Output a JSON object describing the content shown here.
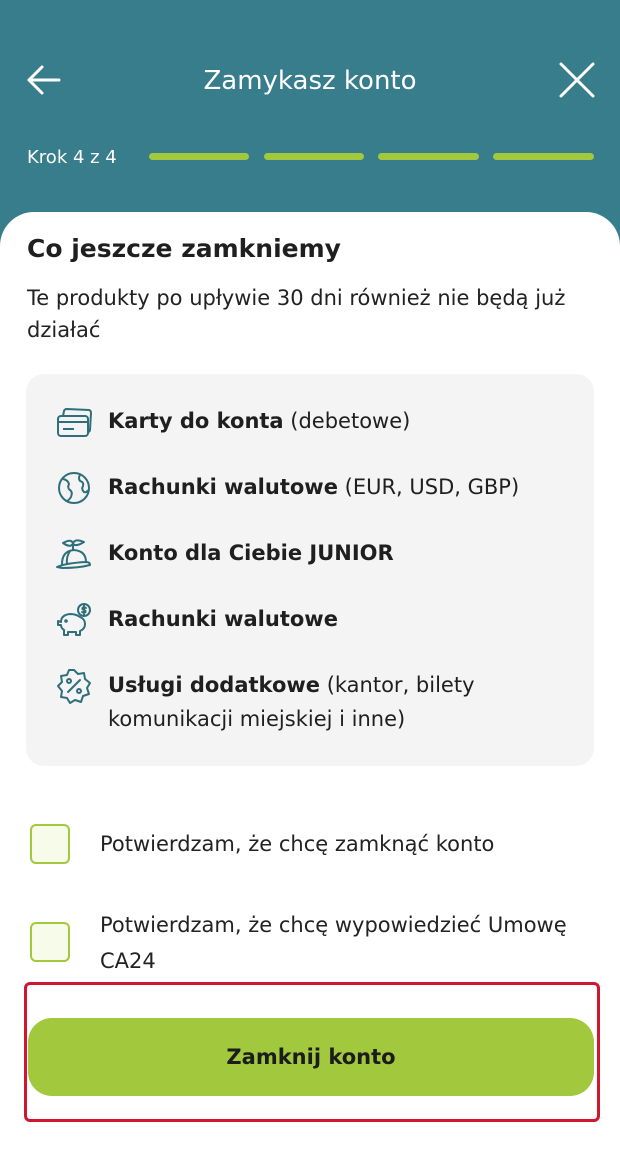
{
  "header": {
    "title": "Zamykasz konto",
    "step_label": "Krok 4 z 4",
    "steps_total": 4,
    "steps_completed": 4,
    "back_icon": "arrow-left-icon",
    "close_icon": "close-icon"
  },
  "content": {
    "heading": "Co jeszcze zamkniemy",
    "subtitle": "Te produkty po upływie 30 dni również nie będą już działać",
    "items": [
      {
        "icon": "card-icon",
        "bold": "Karty do konta",
        "rest": " (debetowe)"
      },
      {
        "icon": "globe-icon",
        "bold": "Rachunki walutowe",
        "rest": " (EUR, USD, GBP)"
      },
      {
        "icon": "propeller-cap-icon",
        "bold": "Konto dla Ciebie JUNIOR",
        "rest": ""
      },
      {
        "icon": "piggy-bank-icon",
        "bold": "Rachunki walutowe",
        "rest": ""
      },
      {
        "icon": "percent-badge-icon",
        "bold": "Usługi dodatkowe",
        "rest": " (kantor, bilety komunikacji miejskiej i inne)"
      }
    ]
  },
  "confirmations": [
    {
      "label": "Potwierdzam, że chcę zamknąć konto",
      "checked": false
    },
    {
      "label": "Potwierdzam, że chcę wypowiedzieć Umowę CA24",
      "checked": false
    }
  ],
  "cta": {
    "label": "Zamknij konto"
  },
  "colors": {
    "header": "#387d8b",
    "accent": "#a2c93d",
    "highlight": "#d0172f",
    "icon": "#2f6f7c"
  }
}
